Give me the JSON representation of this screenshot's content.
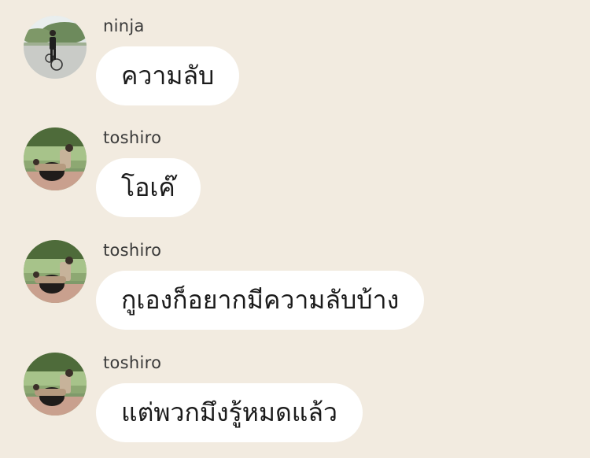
{
  "messages": [
    {
      "sender": "ninja",
      "text": "ความลับ",
      "avatar_icon": "cyclist-photo-avatar"
    },
    {
      "sender": "toshiro",
      "text": "โอเค๊",
      "avatar_icon": "park-photo-avatar"
    },
    {
      "sender": "toshiro",
      "text": "กูเองก็อยากมีความลับบ้าง",
      "avatar_icon": "park-photo-avatar"
    },
    {
      "sender": "toshiro",
      "text": "แต่พวกมึงรู้หมดแล้ว",
      "avatar_icon": "park-photo-avatar"
    }
  ],
  "colors": {
    "background": "#f2ebe0",
    "bubble": "#ffffff",
    "text": "#1b1b1b",
    "username": "#3a3a3a"
  }
}
